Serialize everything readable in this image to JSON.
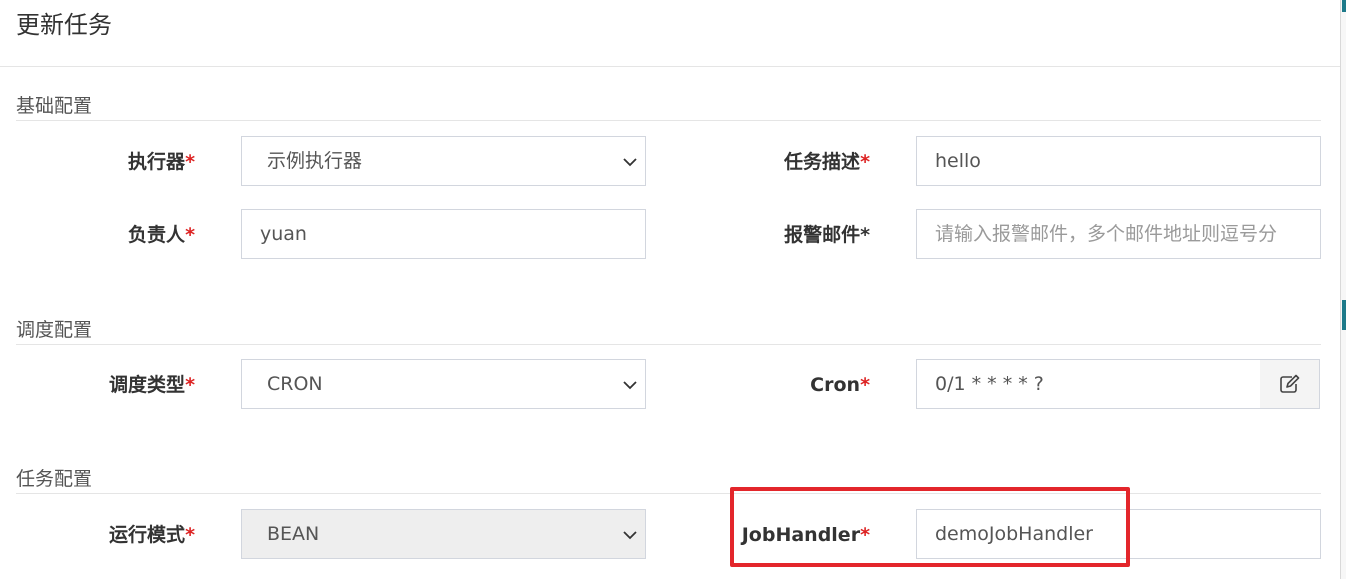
{
  "modal": {
    "title": "更新任务"
  },
  "required_mark": "*",
  "sections": {
    "basic": {
      "title": "基础配置",
      "executor": {
        "label": "执行器",
        "value": "示例执行器"
      },
      "job_desc": {
        "label": "任务描述",
        "value": "hello"
      },
      "author": {
        "label": "负责人",
        "value": "yuan"
      },
      "alarm_email": {
        "label": "报警邮件*",
        "placeholder": "请输入报警邮件，多个邮件地址则逗号分"
      }
    },
    "schedule": {
      "title": "调度配置",
      "schedule_type": {
        "label": "调度类型",
        "value": "CRON"
      },
      "cron": {
        "label": "Cron",
        "value": "0/1 * * * * ?",
        "edit_icon": "edit-icon"
      }
    },
    "task": {
      "title": "任务配置",
      "glue_type": {
        "label": "运行模式",
        "value": "BEAN"
      },
      "job_handler": {
        "label": "JobHandler",
        "value": "demoJobHandler"
      }
    }
  },
  "colors": {
    "required": "#dd2222",
    "highlight": "#e3262b",
    "border": "#d2d6de",
    "disabled_bg": "#eeeeee"
  }
}
